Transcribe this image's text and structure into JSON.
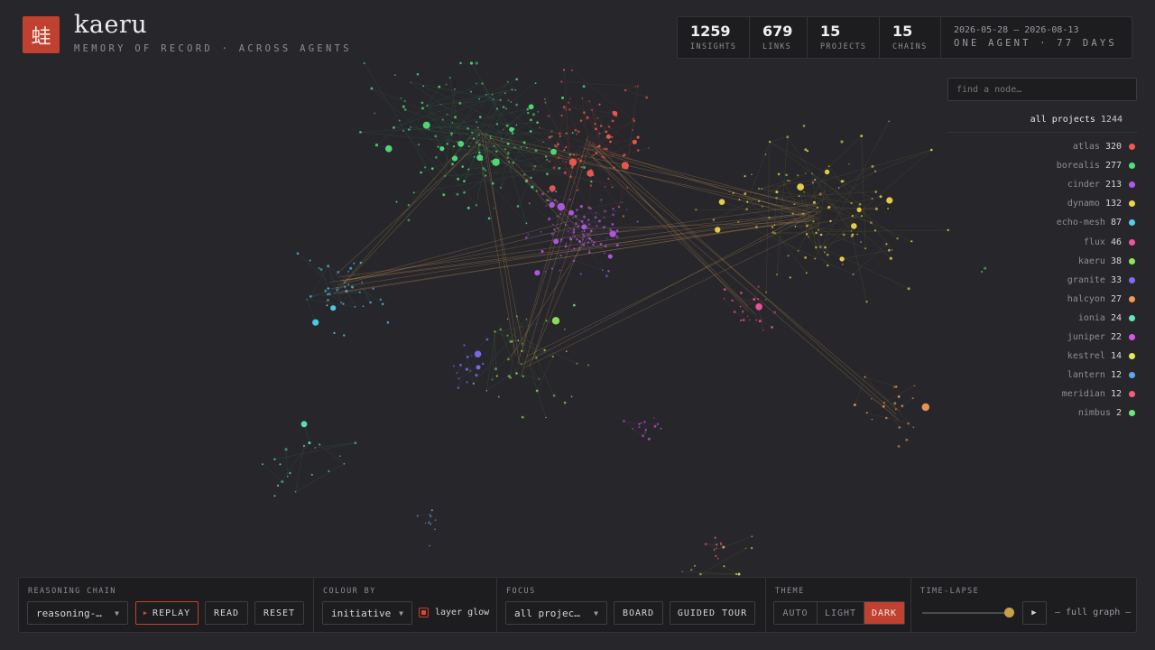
{
  "header": {
    "logo_glyph": "蛙",
    "title": "kaeru",
    "subtitle": "MEMORY OF RECORD · ACROSS AGENTS"
  },
  "stats": [
    {
      "value": "1259",
      "label": "INSIGHTS"
    },
    {
      "value": "679",
      "label": "LINKS"
    },
    {
      "value": "15",
      "label": "PROJECTS"
    },
    {
      "value": "15",
      "label": "CHAINS"
    }
  ],
  "range": {
    "dates": "2026-05-28 — 2026-08-13",
    "agent": "ONE AGENT · 77 DAYS"
  },
  "search": {
    "placeholder": "find a node…"
  },
  "all_projects": {
    "label": "all projects",
    "count": "1244"
  },
  "projects": [
    {
      "name": "atlas",
      "count": "320",
      "color": "#ef5a4e"
    },
    {
      "name": "borealis",
      "count": "277",
      "color": "#4ee07a"
    },
    {
      "name": "cinder",
      "count": "213",
      "color": "#b259e6"
    },
    {
      "name": "dynamo",
      "count": "132",
      "color": "#ecd54a"
    },
    {
      "name": "echo-mesh",
      "count": "87",
      "color": "#4fd0ee"
    },
    {
      "name": "flux",
      "count": "46",
      "color": "#f2559a"
    },
    {
      "name": "kaeru",
      "count": "38",
      "color": "#8ee85a"
    },
    {
      "name": "granite",
      "count": "33",
      "color": "#7b6cf2"
    },
    {
      "name": "halcyon",
      "count": "27",
      "color": "#f09a52"
    },
    {
      "name": "ionia",
      "count": "24",
      "color": "#5ee6c0"
    },
    {
      "name": "juniper",
      "count": "22",
      "color": "#d858e6"
    },
    {
      "name": "kestrel",
      "count": "14",
      "color": "#e6ea5a"
    },
    {
      "name": "lantern",
      "count": "12",
      "color": "#5aa8f2"
    },
    {
      "name": "meridian",
      "count": "12",
      "color": "#f2607e"
    },
    {
      "name": "nimbus",
      "count": "2",
      "color": "#6ee87a"
    }
  ],
  "controls": {
    "reasoning_chain": {
      "label": "REASONING CHAIN",
      "selected": "reasoning-…",
      "replay": "REPLAY",
      "read": "READ",
      "reset": "RESET"
    },
    "colour_by": {
      "label": "COLOUR BY",
      "selected": "initiative",
      "glow_label": "layer glow"
    },
    "focus": {
      "label": "FOCUS",
      "selected": "all projec…",
      "board": "BOARD",
      "tour": "GUIDED TOUR"
    },
    "theme": {
      "label": "THEME",
      "options": [
        "AUTO",
        "LIGHT",
        "DARK"
      ],
      "active": "DARK"
    },
    "timelapse": {
      "label": "TIME-LAPSE",
      "progress": 1.0,
      "status": "— full graph —"
    }
  },
  "colors": {
    "accent": "#c0412f",
    "background": "#27272b",
    "panel": "#1d1d20"
  }
}
